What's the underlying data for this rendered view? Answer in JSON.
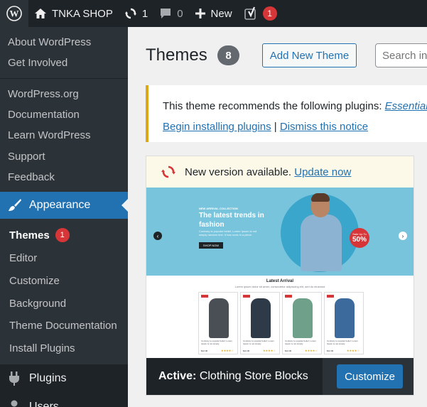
{
  "admin_bar": {
    "site_name": "TNKA SHOP",
    "updates_count": "1",
    "comments_count": "0",
    "new_label": "New",
    "yoast_badge": "1"
  },
  "sidebar": {
    "wp_menu": [
      "About WordPress",
      "Get Involved"
    ],
    "wp_links": [
      "WordPress.org",
      "Documentation",
      "Learn WordPress",
      "Support",
      "Feedback"
    ],
    "appearance_label": "Appearance",
    "appearance_sub": {
      "themes_label": "Themes",
      "themes_badge": "1",
      "items": [
        "Editor",
        "Customize",
        "Background",
        "Theme Documentation",
        "Install Plugins"
      ]
    },
    "plugins_label": "Plugins",
    "users_label": "Users"
  },
  "page": {
    "title": "Themes",
    "count": "8",
    "add_new_label": "Add New Theme",
    "search_placeholder": "Search in"
  },
  "notice": {
    "text": "This theme recommends the following plugins: ",
    "plugin_link": "Essential",
    "begin_link": "Begin installing plugins",
    "separator": " | ",
    "dismiss_link": "Dismiss this notice"
  },
  "theme_card": {
    "update_text": "New version available. ",
    "update_link": "Update now",
    "active_prefix": "Active:",
    "theme_name": "Clothing Store Blocks",
    "customize_label": "Customize",
    "screenshot": {
      "eyebrow": "NEW ARRIVAL COLLECTION",
      "hero_title": "The latest trends in fashion",
      "hero_desc": "Contrary to popular belief, Lorem Ipsum is not simply random text. It has roots in a piece.",
      "hero_button": "SHOP NOW",
      "sale_small": "Sale Up To",
      "sale_big": "50%",
      "arrivals_title": "Latest Arrival",
      "arrivals_subtitle": "Lorem ipsum dolor sit amet, consectetur adipiscing elit, sed do eiusmod",
      "product_text": "Contrary to popular belief, Lorem Ipsum is not simply",
      "product_price": "$12.00",
      "product_stars": "★★★★☆",
      "product_colors": [
        "#4a4f55",
        "#2f3a48",
        "#6fa08a",
        "#3d6a9c"
      ]
    }
  },
  "colors": {
    "admin_bg": "#1d2327",
    "accent": "#2271b1",
    "badge_red": "#d63638",
    "notice_yellow": "#dba617"
  }
}
